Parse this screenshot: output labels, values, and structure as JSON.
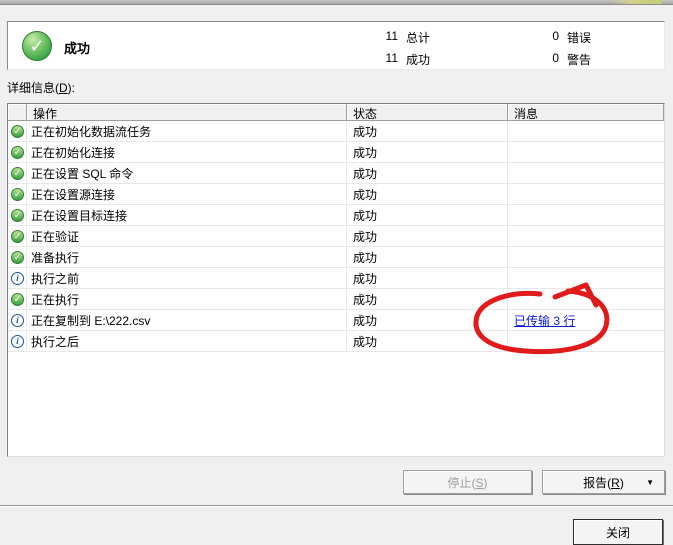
{
  "summary": {
    "status_label": "成功",
    "status_icon": "success-check-icon",
    "check_glyph": "✓",
    "stats": [
      {
        "value": "11",
        "label": "总计"
      },
      {
        "value": "11",
        "label": "成功"
      },
      {
        "value": "0",
        "label": "错误"
      },
      {
        "value": "0",
        "label": "警告"
      }
    ]
  },
  "details": {
    "label_pre": "详细信息(",
    "label_mnemonic": "D",
    "label_post": "):"
  },
  "table": {
    "columns": [
      {
        "label": ""
      },
      {
        "label": "操作"
      },
      {
        "label": "状态"
      },
      {
        "label": "消息"
      }
    ],
    "rows": [
      {
        "icon": "success-check-icon",
        "operation": "正在初始化数据流任务",
        "status": "成功",
        "message": ""
      },
      {
        "icon": "success-check-icon",
        "operation": "正在初始化连接",
        "status": "成功",
        "message": ""
      },
      {
        "icon": "success-check-icon",
        "operation": "正在设置 SQL 命令",
        "status": "成功",
        "message": ""
      },
      {
        "icon": "success-check-icon",
        "operation": "正在设置源连接",
        "status": "成功",
        "message": ""
      },
      {
        "icon": "success-check-icon",
        "operation": "正在设置目标连接",
        "status": "成功",
        "message": ""
      },
      {
        "icon": "success-check-icon",
        "operation": "正在验证",
        "status": "成功",
        "message": ""
      },
      {
        "icon": "success-check-icon",
        "operation": "准备执行",
        "status": "成功",
        "message": ""
      },
      {
        "icon": "info-icon",
        "operation": "执行之前",
        "status": "成功",
        "message": ""
      },
      {
        "icon": "success-check-icon",
        "operation": "正在执行",
        "status": "成功",
        "message": ""
      },
      {
        "icon": "info-icon",
        "operation": "正在复制到 E:\\222.csv",
        "status": "成功",
        "message": "已传输 3 行",
        "message_is_link": true
      },
      {
        "icon": "info-icon",
        "operation": "执行之后",
        "status": "成功",
        "message": ""
      }
    ]
  },
  "buttons": {
    "stop": {
      "pre": "停止(",
      "mnemonic": "S",
      "post": ")",
      "enabled": false
    },
    "report": {
      "pre": "报告(",
      "mnemonic": "R",
      "post": ")",
      "dropdown_icon": "chevron-down-icon",
      "arrow_glyph": "▼"
    },
    "close": {
      "label": "关闭"
    }
  },
  "colors": {
    "success_green": "#2f9e44",
    "info_blue": "#16549c",
    "link_blue": "#0b1bd0",
    "annotation_red": "#e01b1b",
    "dialog_bg": "#f0f0f0"
  },
  "annotation": {
    "shape": "hand-drawn-circle",
    "target": "已传输 3 行 link"
  }
}
